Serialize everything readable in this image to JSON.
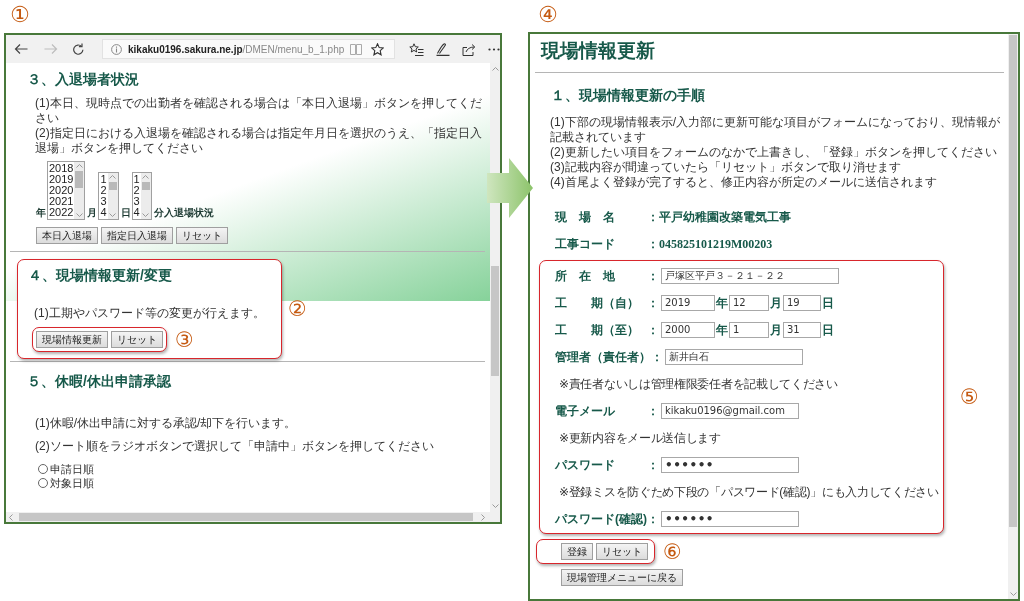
{
  "left_window": {
    "callout": "①",
    "browser": {
      "forward_disabled": true,
      "url_host": "kikaku0196.sakura.ne.jp",
      "url_path": "/DMEN/menu_b_1.php"
    },
    "attendance": {
      "heading": "３、入退場者状況",
      "notes": [
        "(1)本日、現時点での出勤者を確認される場合は「本日入退場」ボタンを押してください",
        "(2)指定日における入退場を確認される場合は指定年月日を選択のうえ、「指定日入退場」ボタンを押してください"
      ],
      "date_pickers": [
        {
          "label": "年",
          "options": [
            "2018",
            "2019",
            "2020",
            "2021",
            "2022"
          ]
        },
        {
          "label": "月",
          "options": [
            "1",
            "2",
            "3",
            "4"
          ]
        },
        {
          "label": "日",
          "options": [
            "1",
            "2",
            "3",
            "4"
          ]
        }
      ],
      "suffix": "分入退場状況",
      "buttons": [
        "本日入退場",
        "指定日入退場",
        "リセット"
      ]
    },
    "site_update": {
      "callout": "②",
      "heading": "４、現場情報更新/変更",
      "notes": [
        "(1)工期やパスワード等の変更が行えます。"
      ],
      "buttons_callout": "③",
      "buttons": [
        "現場情報更新",
        "リセット"
      ]
    },
    "leave_approval": {
      "heading": "５、休暇/休出申請承認",
      "notes": [
        "(1)休暇/休出申請に対する承認/却下を行います。",
        "(2)ソート順をラジオボタンで選択して「申請中」ボタンを押してください"
      ],
      "sort_options": [
        {
          "label": "申請日順",
          "selected": false
        },
        {
          "label": "対象日順",
          "selected": false
        }
      ]
    }
  },
  "right_window": {
    "callout": "④",
    "title": "現場情報更新",
    "heading": "１、現場情報更新の手順",
    "notes": [
      "(1)下部の現場情報表示/入力部に更新可能な項目がフォームになっており、現情報が記載されています",
      "(2)更新したい項目をフォームのなかで上書きし、「登録」ボタンを押してください",
      "(3)記載内容が間違っていたら「リセット」ボタンで取り消せます",
      "(4)首尾よく登録が完了すると、修正内容が所定のメールに送信されます"
    ],
    "info_rows": [
      {
        "label": "現　場　名",
        "colon": "：",
        "value": "平戸幼稚園改築電気工事"
      },
      {
        "label": "工事コード",
        "colon": "：",
        "value": "045825101219M00203"
      }
    ],
    "form_callout": "⑤",
    "form_rows": [
      {
        "kind": "text",
        "label": "所　在　地",
        "colon": "：",
        "value": "戸塚区平戸３－２１－２２"
      },
      {
        "kind": "date",
        "label": "工　　期（自）",
        "colon": "：",
        "parts": [
          {
            "value": "2019",
            "unit": "年"
          },
          {
            "value": "12",
            "unit": "月"
          },
          {
            "value": "19",
            "unit": "日"
          }
        ]
      },
      {
        "kind": "date",
        "label": "工　　期（至）",
        "colon": "：",
        "parts": [
          {
            "value": "2000",
            "unit": "年"
          },
          {
            "value": "1",
            "unit": "月"
          },
          {
            "value": "31",
            "unit": "日"
          }
        ]
      },
      {
        "kind": "text",
        "label": "管理者（責任者）",
        "colon": "：",
        "value": "新井白石"
      },
      {
        "kind": "note",
        "text": "※責任者ないしは管理権限委任者を記載してください"
      },
      {
        "kind": "text",
        "label": "電子メール",
        "colon": "：",
        "value": "kikaku0196@gmail.com"
      },
      {
        "kind": "note",
        "text": "※更新内容をメール送信します"
      },
      {
        "kind": "password",
        "label": "パスワード",
        "colon": "：",
        "value": "••••••"
      },
      {
        "kind": "note",
        "text": "※登録ミスを防ぐため下段の「パスワード(確認)」にも入力してください"
      },
      {
        "kind": "password",
        "label": "パスワード(確認)",
        "colon": "：",
        "value": "••••••"
      }
    ],
    "buttons_callout": "⑥",
    "buttons": [
      "登録",
      "リセット"
    ],
    "back_button": "現場管理メニューに戻る"
  }
}
